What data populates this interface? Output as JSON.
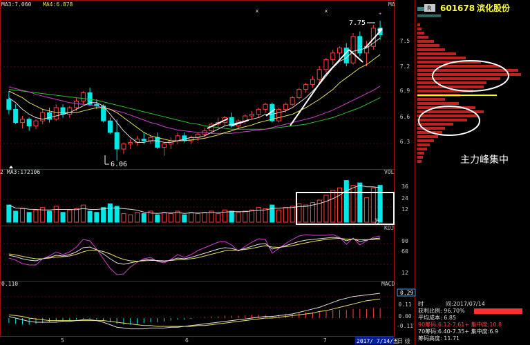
{
  "stock": {
    "box": "R",
    "code": "601678",
    "name": "滨化股份"
  },
  "indicators": {
    "price": {
      "a_label": "MA3:7.060",
      "b_label": "MA4:6.878",
      "corner": "MA"
    },
    "vol": {
      "a_label": "MA3:172106",
      "corner": "VOL",
      "unit": "万",
      "lead": "2"
    },
    "kdj": {
      "corner": "KDJ"
    },
    "macd": {
      "a_label": "0.110",
      "corner": "MACD",
      "value_box": "0.29"
    }
  },
  "annotations": {
    "high": "7.75",
    "low": "6.06",
    "chip_label": "主力峰集中"
  },
  "right_axes": {
    "price": [
      "7.5",
      "7.2",
      "6.9",
      "6.6",
      "6.3"
    ],
    "vol": [
      "36",
      "24",
      "12"
    ],
    "kdj": [
      "90",
      "60",
      "12"
    ],
    "macd": [
      "0.11",
      "0.00",
      "-0.11"
    ]
  },
  "x_axis": [
    "5",
    "6",
    "7"
  ],
  "date_box": "2017/ 7/14/五",
  "day_box": "日 线",
  "info": {
    "date_label": "时",
    "date_value": "间:2017/07/14",
    "win_label": "获利比例: 96.70%",
    "avg_label": "平均成本: 6.85",
    "chip90": "90筹码:6.12-7.61+ 集中度:10.8",
    "chip70": "70筹码:6.40-7.35+ 集中度:6.9",
    "chip_high": "筹码高度: 11.71"
  },
  "colors": {
    "up": "#ff4040",
    "down": "#00e8e8",
    "ma5": "#e0e0e0",
    "ma10": "#e8e060",
    "ma20": "#d040d0",
    "ma60": "#30c030",
    "chip": "#c02020",
    "avg": "#ffff00"
  },
  "chart_data": {
    "type": "candlestick",
    "x_axis_ticks": [
      "5",
      "6",
      "7"
    ],
    "price_range": [
      6.0,
      7.9
    ],
    "candles": [
      [
        6.8,
        6.9,
        6.62,
        6.68
      ],
      [
        6.68,
        6.74,
        6.5,
        6.52
      ],
      [
        6.52,
        6.6,
        6.45,
        6.56
      ],
      [
        6.56,
        6.58,
        6.42,
        6.48
      ],
      [
        6.48,
        6.56,
        6.44,
        6.54
      ],
      [
        6.54,
        6.68,
        6.5,
        6.64
      ],
      [
        6.64,
        6.7,
        6.52,
        6.56
      ],
      [
        6.56,
        6.74,
        6.54,
        6.7
      ],
      [
        6.7,
        6.74,
        6.58,
        6.62
      ],
      [
        6.62,
        6.72,
        6.58,
        6.7
      ],
      [
        6.7,
        6.82,
        6.66,
        6.78
      ],
      [
        6.78,
        6.9,
        6.74,
        6.88
      ],
      [
        6.88,
        6.94,
        6.72,
        6.74
      ],
      [
        6.74,
        6.8,
        6.68,
        6.72
      ],
      [
        6.72,
        6.74,
        6.52,
        6.54
      ],
      [
        6.54,
        6.58,
        6.38,
        6.4
      ],
      [
        6.4,
        6.56,
        6.06,
        6.2
      ],
      [
        6.2,
        6.28,
        6.14,
        6.26
      ],
      [
        6.26,
        6.32,
        6.2,
        6.28
      ],
      [
        6.28,
        6.36,
        6.24,
        6.32
      ],
      [
        6.32,
        6.4,
        6.26,
        6.3
      ],
      [
        6.3,
        6.36,
        6.26,
        6.34
      ],
      [
        6.34,
        6.4,
        6.2,
        6.22
      ],
      [
        6.22,
        6.28,
        6.12,
        6.26
      ],
      [
        6.26,
        6.34,
        6.2,
        6.3
      ],
      [
        6.3,
        6.4,
        6.26,
        6.36
      ],
      [
        6.36,
        6.4,
        6.28,
        6.3
      ],
      [
        6.3,
        6.36,
        6.26,
        6.34
      ],
      [
        6.34,
        6.4,
        6.3,
        6.38
      ],
      [
        6.38,
        6.46,
        6.34,
        6.42
      ],
      [
        6.42,
        6.52,
        6.4,
        6.5
      ],
      [
        6.5,
        6.58,
        6.46,
        6.52
      ],
      [
        6.52,
        6.6,
        6.48,
        6.58
      ],
      [
        6.58,
        6.64,
        6.46,
        6.48
      ],
      [
        6.48,
        6.56,
        6.44,
        6.54
      ],
      [
        6.54,
        6.62,
        6.5,
        6.6
      ],
      [
        6.6,
        6.66,
        6.56,
        6.62
      ],
      [
        6.62,
        6.7,
        6.58,
        6.68
      ],
      [
        6.68,
        6.76,
        6.64,
        6.74
      ],
      [
        6.74,
        6.76,
        6.52,
        6.54
      ],
      [
        6.54,
        6.7,
        6.52,
        6.68
      ],
      [
        6.68,
        6.76,
        6.64,
        6.74
      ],
      [
        6.74,
        6.84,
        6.72,
        6.82
      ],
      [
        6.82,
        6.94,
        6.8,
        6.92
      ],
      [
        6.92,
        7.0,
        6.88,
        6.98
      ],
      [
        6.98,
        7.08,
        6.94,
        7.04
      ],
      [
        7.04,
        7.2,
        7.0,
        7.16
      ],
      [
        7.16,
        7.3,
        7.12,
        7.28
      ],
      [
        7.28,
        7.4,
        7.22,
        7.36
      ],
      [
        7.36,
        7.44,
        7.28,
        7.42
      ],
      [
        7.42,
        7.48,
        7.2,
        7.24
      ],
      [
        7.24,
        7.6,
        7.22,
        7.56
      ],
      [
        7.56,
        7.62,
        7.32,
        7.36
      ],
      [
        7.36,
        7.5,
        7.2,
        7.44
      ],
      [
        7.44,
        7.7,
        7.4,
        7.66
      ],
      [
        7.66,
        7.75,
        7.52,
        7.58
      ]
    ],
    "ma5": [
      6.82,
      6.76,
      6.68,
      6.62,
      6.58,
      6.56,
      6.58,
      6.6,
      6.62,
      6.64,
      6.68,
      6.72,
      6.76,
      6.76,
      6.72,
      6.62,
      6.52,
      6.42,
      6.34,
      6.28,
      6.28,
      6.3,
      6.3,
      6.28,
      6.28,
      6.3,
      6.32,
      6.34,
      6.34,
      6.36,
      6.4,
      6.44,
      6.48,
      6.5,
      6.52,
      6.54,
      6.56,
      6.58,
      6.62,
      6.62,
      6.64,
      6.66,
      6.7,
      6.76,
      6.82,
      6.9,
      6.98,
      7.08,
      7.18,
      7.26,
      7.3,
      7.38,
      7.4,
      7.42,
      7.48,
      7.54
    ],
    "ma10": [
      6.9,
      6.86,
      6.82,
      6.76,
      6.72,
      6.68,
      6.66,
      6.64,
      6.64,
      6.64,
      6.64,
      6.66,
      6.68,
      6.7,
      6.7,
      6.68,
      6.64,
      6.58,
      6.52,
      6.46,
      6.4,
      6.36,
      6.34,
      6.32,
      6.3,
      6.3,
      6.3,
      6.31,
      6.32,
      6.33,
      6.35,
      6.37,
      6.4,
      6.42,
      6.45,
      6.47,
      6.49,
      6.52,
      6.54,
      6.56,
      6.58,
      6.6,
      6.62,
      6.66,
      6.7,
      6.75,
      6.8,
      6.86,
      6.92,
      7.0,
      7.06,
      7.12,
      7.18,
      7.22,
      7.28,
      7.34
    ],
    "ma20": [
      6.95,
      6.93,
      6.91,
      6.89,
      6.86,
      6.84,
      6.82,
      6.8,
      6.78,
      6.76,
      6.75,
      6.74,
      6.73,
      6.72,
      6.7,
      6.68,
      6.66,
      6.64,
      6.61,
      6.58,
      6.55,
      6.52,
      6.5,
      6.47,
      6.45,
      6.43,
      6.42,
      6.41,
      6.4,
      6.4,
      6.39,
      6.39,
      6.39,
      6.39,
      6.4,
      6.41,
      6.42,
      6.43,
      6.44,
      6.46,
      6.48,
      6.5,
      6.52,
      6.54,
      6.56,
      6.58,
      6.61,
      6.64,
      6.67,
      6.71,
      6.75,
      6.79,
      6.83,
      6.87,
      6.91,
      6.96
    ],
    "ma60": [
      6.92,
      6.91,
      6.9,
      6.89,
      6.88,
      6.87,
      6.86,
      6.85,
      6.84,
      6.83,
      6.82,
      6.81,
      6.8,
      6.79,
      6.77,
      6.75,
      6.73,
      6.71,
      6.69,
      6.67,
      6.65,
      6.63,
      6.61,
      6.59,
      6.57,
      6.55,
      6.53,
      6.51,
      6.5,
      6.48,
      6.47,
      6.46,
      6.45,
      6.44,
      6.44,
      6.44,
      6.44,
      6.44,
      6.44,
      6.45,
      6.46,
      6.47,
      6.48,
      6.49,
      6.5,
      6.52,
      6.54,
      6.56,
      6.58,
      6.61,
      6.64,
      6.67,
      6.7,
      6.74,
      6.78,
      6.82
    ],
    "volume": [
      14,
      9,
      11,
      8,
      10,
      12,
      9,
      13,
      8,
      10,
      11,
      14,
      9,
      8,
      12,
      15,
      13,
      7,
      6,
      8,
      7,
      9,
      6,
      8,
      7,
      9,
      6,
      8,
      7,
      8,
      9,
      7,
      10,
      9,
      8,
      9,
      10,
      12,
      11,
      14,
      10,
      12,
      13,
      15,
      14,
      16,
      18,
      22,
      26,
      28,
      34,
      30,
      32,
      20,
      28,
      30
    ],
    "kdj_k": [
      40,
      36,
      30,
      26,
      24,
      30,
      34,
      40,
      38,
      42,
      50,
      62,
      64,
      56,
      44,
      30,
      18,
      14,
      18,
      22,
      26,
      28,
      24,
      22,
      26,
      32,
      30,
      34,
      40,
      46,
      52,
      58,
      62,
      60,
      54,
      60,
      66,
      72,
      74,
      58,
      62,
      68,
      74,
      80,
      84,
      86,
      88,
      90,
      92,
      90,
      82,
      88,
      80,
      84,
      88,
      90
    ],
    "kdj_d": [
      44,
      41,
      37,
      33,
      30,
      30,
      32,
      35,
      36,
      38,
      43,
      50,
      55,
      55,
      51,
      44,
      35,
      28,
      24,
      23,
      24,
      25,
      25,
      24,
      25,
      27,
      28,
      30,
      33,
      38,
      43,
      48,
      53,
      55,
      55,
      57,
      60,
      64,
      68,
      64,
      63,
      65,
      68,
      72,
      76,
      80,
      83,
      86,
      88,
      89,
      87,
      87,
      85,
      85,
      86,
      87
    ],
    "kdj_j": [
      32,
      26,
      16,
      12,
      12,
      30,
      38,
      50,
      42,
      50,
      64,
      86,
      82,
      58,
      30,
      2,
      -16,
      -14,
      6,
      20,
      30,
      34,
      22,
      18,
      28,
      42,
      34,
      42,
      54,
      62,
      70,
      78,
      80,
      70,
      52,
      66,
      78,
      88,
      86,
      46,
      60,
      74,
      86,
      96,
      100,
      98,
      98,
      98,
      100,
      92,
      72,
      90,
      70,
      82,
      92,
      96
    ],
    "macd_bar": [
      -0.06,
      -0.07,
      -0.08,
      -0.08,
      -0.07,
      -0.06,
      -0.05,
      -0.04,
      -0.04,
      -0.03,
      -0.02,
      -0.01,
      -0.01,
      -0.02,
      -0.03,
      -0.05,
      -0.07,
      -0.08,
      -0.08,
      -0.07,
      -0.06,
      -0.05,
      -0.05,
      -0.04,
      -0.03,
      -0.02,
      -0.02,
      -0.01,
      0.0,
      0.01,
      0.02,
      0.02,
      0.03,
      0.03,
      0.03,
      0.03,
      0.04,
      0.04,
      0.04,
      0.03,
      0.04,
      0.05,
      0.05,
      0.06,
      0.07,
      0.07,
      0.08,
      0.09,
      0.1,
      0.1,
      0.1,
      0.11,
      0.11,
      0.11,
      0.12,
      0.12
    ],
    "macd_dif": [
      0.02,
      0.0,
      -0.02,
      -0.04,
      -0.05,
      -0.05,
      -0.05,
      -0.05,
      -0.04,
      -0.04,
      -0.03,
      -0.02,
      -0.02,
      -0.03,
      -0.05,
      -0.08,
      -0.11,
      -0.12,
      -0.13,
      -0.13,
      -0.13,
      -0.12,
      -0.12,
      -0.12,
      -0.11,
      -0.11,
      -0.1,
      -0.09,
      -0.08,
      -0.07,
      -0.06,
      -0.05,
      -0.04,
      -0.03,
      -0.02,
      -0.01,
      0.0,
      0.01,
      0.02,
      0.02,
      0.03,
      0.04,
      0.05,
      0.07,
      0.09,
      0.11,
      0.13,
      0.16,
      0.19,
      0.22,
      0.24,
      0.26,
      0.27,
      0.28,
      0.29,
      0.3
    ],
    "macd_dea": [
      0.04,
      0.03,
      0.02,
      0.0,
      -0.01,
      -0.02,
      -0.03,
      -0.03,
      -0.03,
      -0.03,
      -0.03,
      -0.03,
      -0.03,
      -0.03,
      -0.03,
      -0.04,
      -0.05,
      -0.06,
      -0.07,
      -0.08,
      -0.09,
      -0.09,
      -0.1,
      -0.1,
      -0.1,
      -0.1,
      -0.1,
      -0.1,
      -0.09,
      -0.09,
      -0.08,
      -0.07,
      -0.06,
      -0.05,
      -0.04,
      -0.03,
      -0.02,
      -0.01,
      0.0,
      0.0,
      0.01,
      0.02,
      0.03,
      0.04,
      0.05,
      0.06,
      0.08,
      0.09,
      0.11,
      0.13,
      0.15,
      0.17,
      0.19,
      0.21,
      0.22,
      0.23
    ],
    "chip_distribution": {
      "prices": [
        6.05,
        6.1,
        6.15,
        6.2,
        6.25,
        6.3,
        6.35,
        6.4,
        6.45,
        6.5,
        6.55,
        6.6,
        6.65,
        6.7,
        6.75,
        6.8,
        6.85,
        6.9,
        6.95,
        7.0,
        7.05,
        7.1,
        7.15,
        7.2,
        7.25,
        7.3,
        7.35,
        7.4,
        7.45,
        7.5,
        7.55,
        7.6,
        7.65,
        7.7
      ],
      "amounts": [
        6,
        8,
        10,
        14,
        18,
        24,
        30,
        36,
        40,
        52,
        72,
        88,
        96,
        84,
        60,
        40,
        62,
        80,
        96,
        100,
        120,
        150,
        146,
        120,
        92,
        70,
        56,
        40,
        32,
        24,
        16,
        10,
        6,
        4
      ],
      "avg_cost": 6.85
    }
  }
}
